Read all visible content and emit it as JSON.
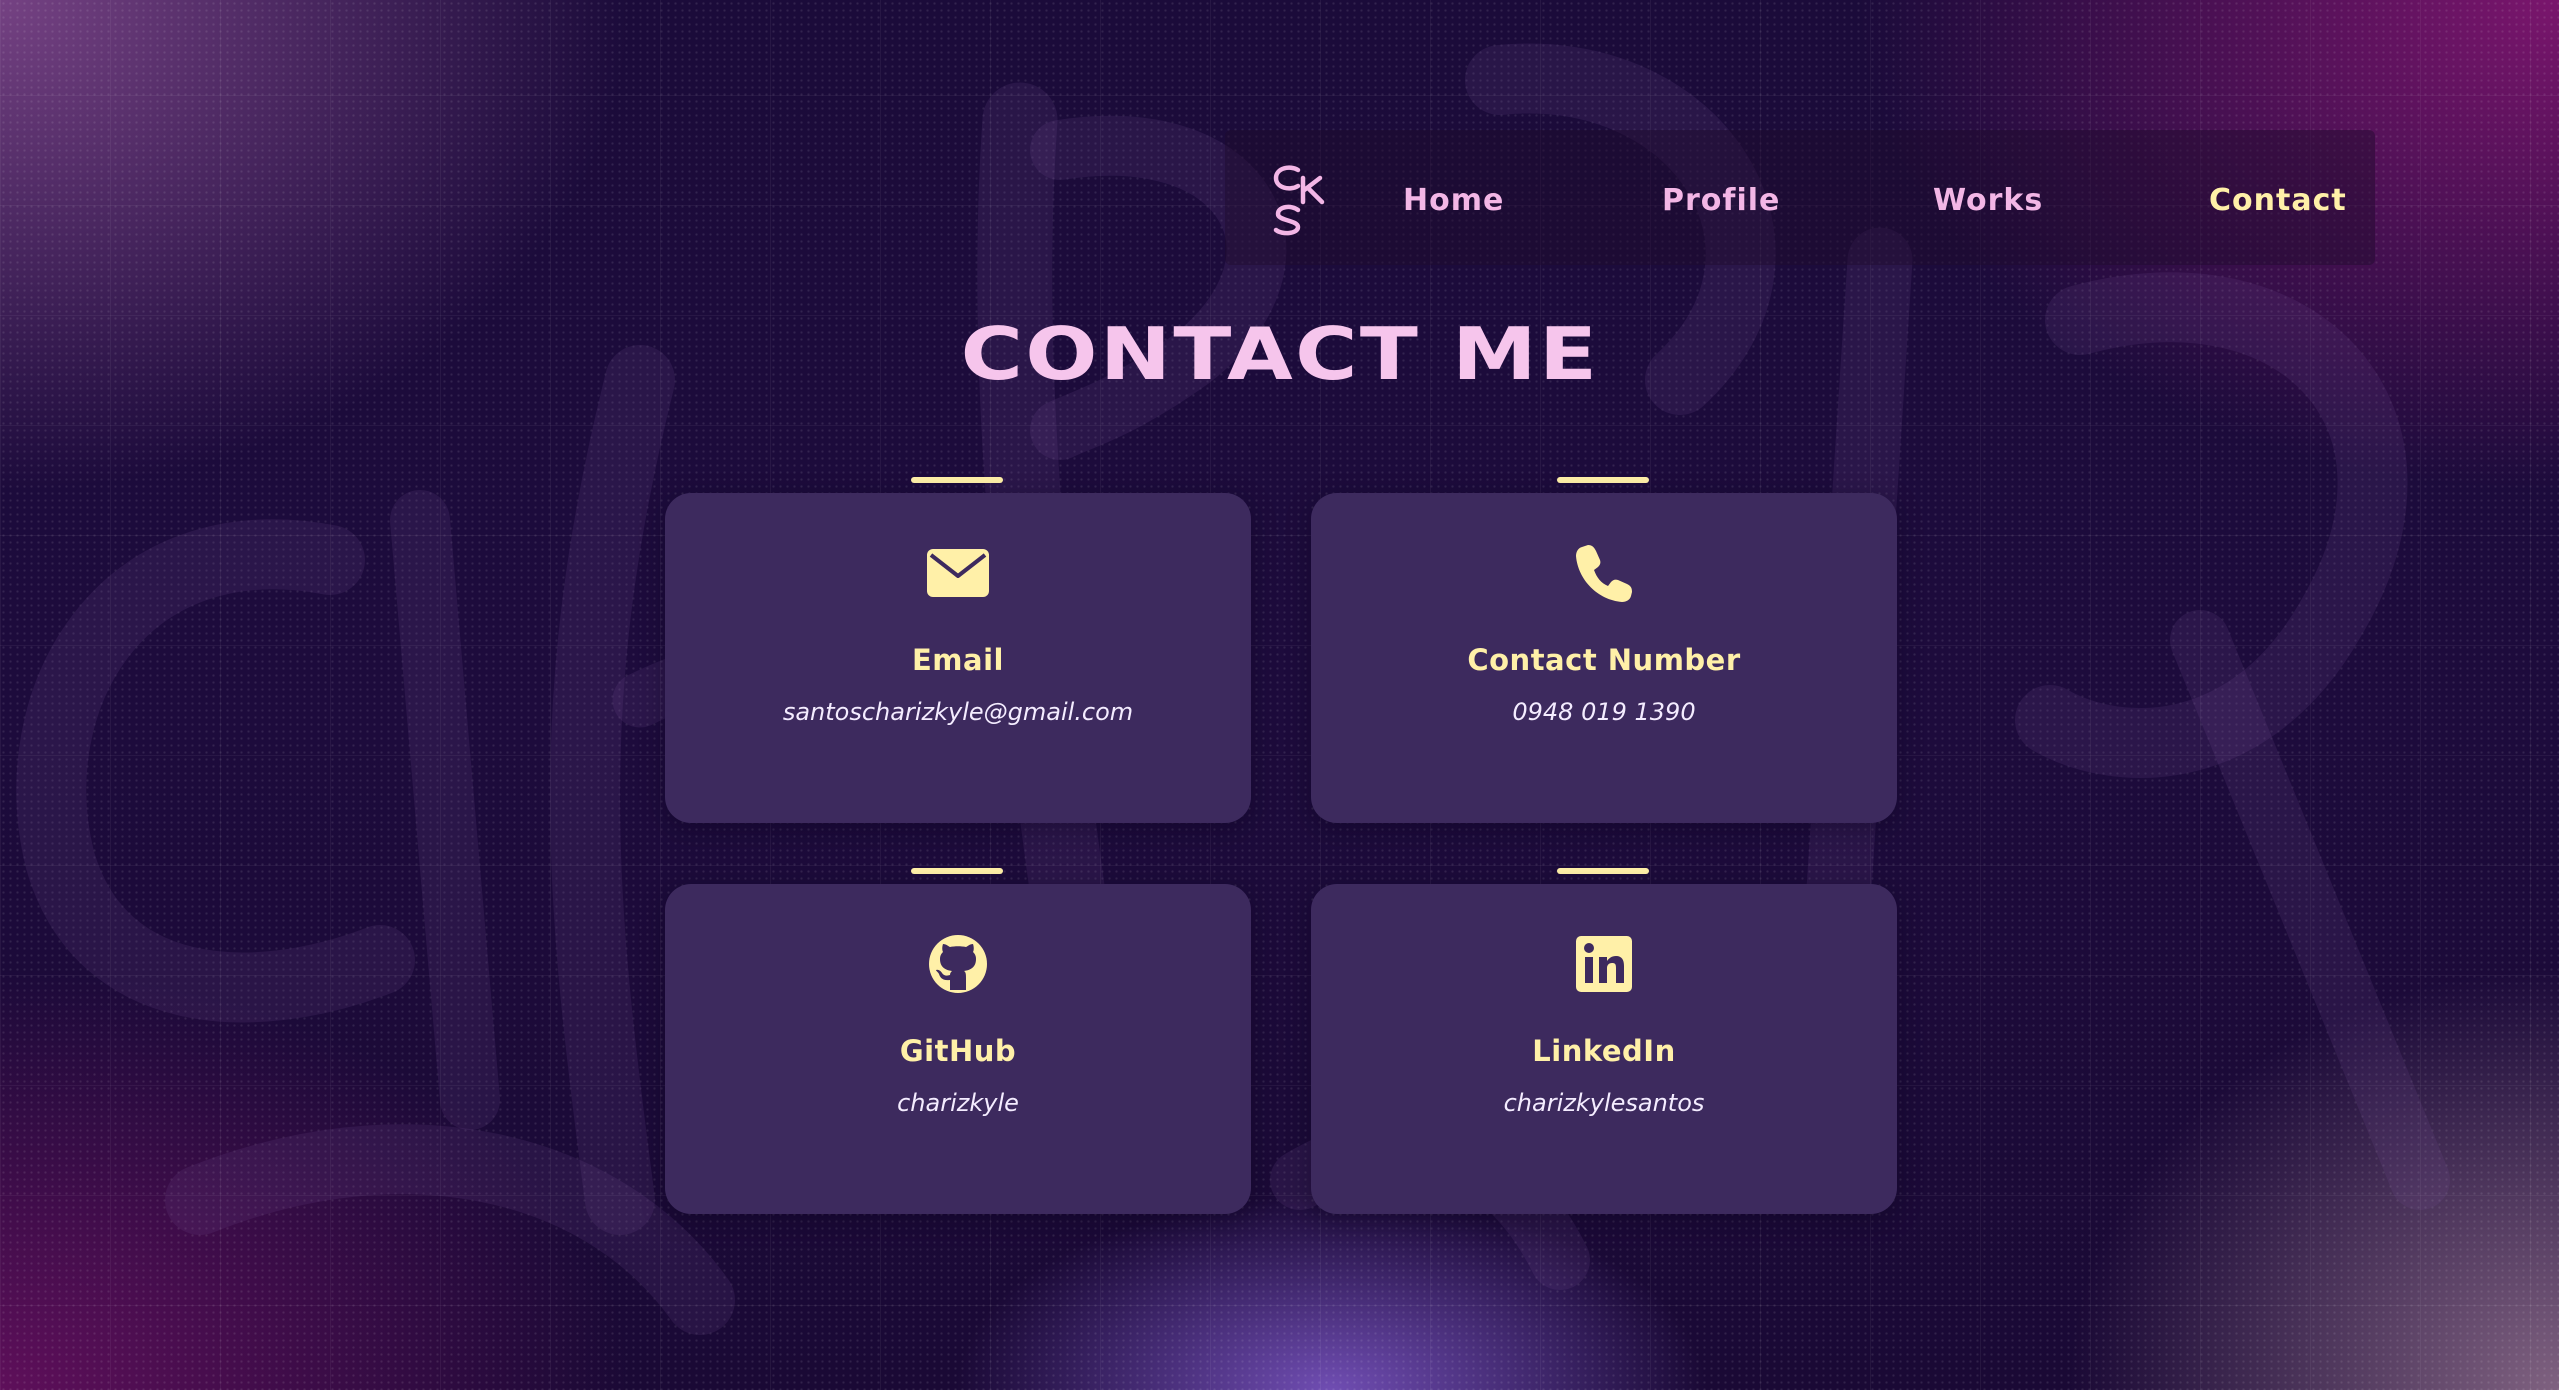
{
  "logo": {
    "text": "CSK"
  },
  "nav": {
    "items": [
      {
        "label": "Home"
      },
      {
        "label": "Profile"
      },
      {
        "label": "Works"
      },
      {
        "label": "Contact"
      }
    ],
    "active": "Contact"
  },
  "page": {
    "title": "CONTACT ME"
  },
  "contacts": [
    {
      "label": "Email",
      "value": "santoscharizkyle@gmail.com",
      "icon": "envelope-icon"
    },
    {
      "label": "Contact Number",
      "value": "0948 019 1390",
      "icon": "phone-icon"
    },
    {
      "label": "GitHub",
      "value": "charizkyle",
      "icon": "github-icon"
    },
    {
      "label": "LinkedIn",
      "value": "charizkylesantos",
      "icon": "linkedin-icon"
    }
  ],
  "colors": {
    "accent_yellow": "#fff0a8",
    "accent_pink": "#f3b6e6",
    "card_bg": "#3d2a5e",
    "page_bg": "#1b0b3a"
  }
}
